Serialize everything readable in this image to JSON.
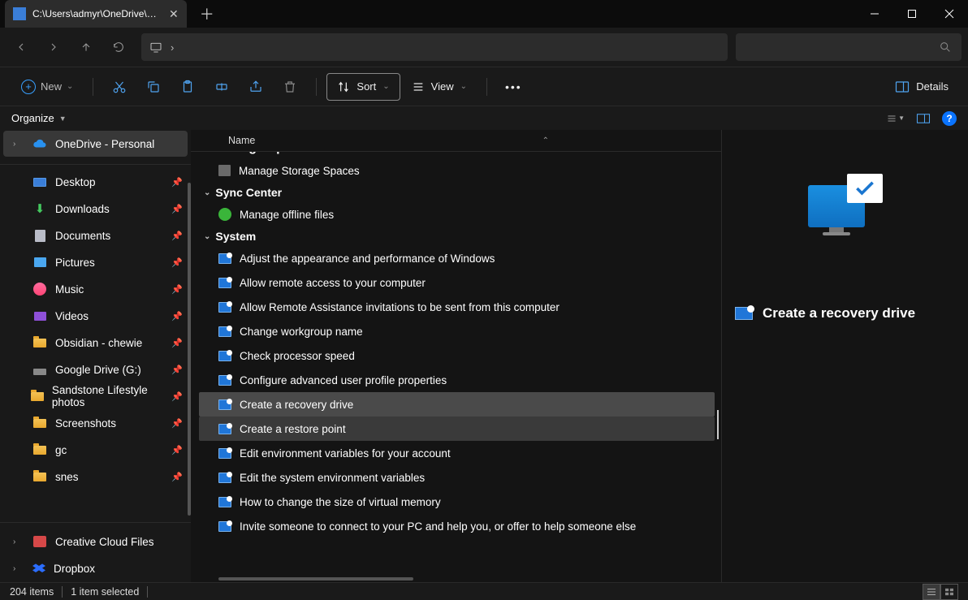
{
  "titlebar": {
    "tab_title": "C:\\Users\\admyr\\OneDrive\\Des"
  },
  "toolbar": {
    "new_label": "New",
    "sort_label": "Sort",
    "view_label": "View",
    "details_label": "Details"
  },
  "organize": {
    "label": "Organize"
  },
  "sidebar": {
    "top": {
      "label": "OneDrive - Personal"
    },
    "quick": [
      {
        "label": "Desktop",
        "icon": "monitor"
      },
      {
        "label": "Downloads",
        "icon": "download"
      },
      {
        "label": "Documents",
        "icon": "doc"
      },
      {
        "label": "Pictures",
        "icon": "pic"
      },
      {
        "label": "Music",
        "icon": "music"
      },
      {
        "label": "Videos",
        "icon": "video"
      },
      {
        "label": "Obsidian - chewie",
        "icon": "folder"
      },
      {
        "label": "Google Drive (G:)",
        "icon": "drive"
      },
      {
        "label": "Sandstone Lifestyle photos",
        "icon": "folder"
      },
      {
        "label": "Screenshots",
        "icon": "folder"
      },
      {
        "label": "gc",
        "icon": "folder"
      },
      {
        "label": "snes",
        "icon": "folder"
      }
    ],
    "bottom": [
      {
        "label": "Creative Cloud Files",
        "icon": "cc"
      },
      {
        "label": "Dropbox",
        "icon": "dropbox"
      }
    ]
  },
  "list": {
    "header": "Name",
    "group_cut": "Storage Spaces",
    "group_cut_items": [
      {
        "label": "Manage Storage Spaces"
      }
    ],
    "group2": "Sync Center",
    "group2_items": [
      {
        "label": "Manage offline files"
      }
    ],
    "group3": "System",
    "group3_items": [
      {
        "label": "Adjust the appearance and performance of Windows"
      },
      {
        "label": "Allow remote access to your computer"
      },
      {
        "label": "Allow Remote Assistance invitations to be sent from this computer"
      },
      {
        "label": "Change workgroup name"
      },
      {
        "label": "Check processor speed"
      },
      {
        "label": "Configure advanced user profile properties"
      },
      {
        "label": "Create a recovery drive"
      },
      {
        "label": "Create a restore point"
      },
      {
        "label": "Edit environment variables for your account"
      },
      {
        "label": "Edit the system environment variables"
      },
      {
        "label": "How to change the size of virtual memory"
      },
      {
        "label": "Invite someone to connect to your PC and help you, or offer to help someone else"
      }
    ]
  },
  "preview": {
    "title": "Create a recovery drive"
  },
  "status": {
    "count": "204 items",
    "selected": "1 item selected"
  }
}
